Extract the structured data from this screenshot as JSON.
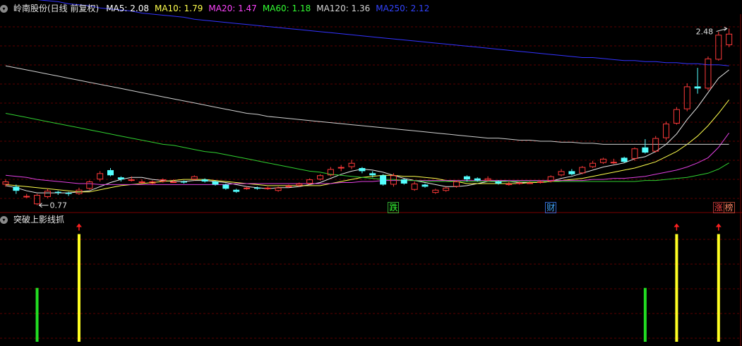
{
  "colors": {
    "background": "#000000",
    "grid": "#5a0000",
    "up_candle": "#ff3a3a",
    "down_candle": "#54ffff",
    "ma5": "#e8e8e8",
    "ma10": "#ffff4d",
    "ma20": "#e040e0",
    "ma60": "#30d030",
    "ma120": "#d0d0d0",
    "ma250": "#3333ff",
    "signal_green": "#22dd22",
    "signal_yellow": "#ffff22",
    "arrow_red": "#ff2020"
  },
  "header": {
    "collapse_icon": "chevron-down-icon",
    "stock_title": "岭南股份(日线 前复权)",
    "ma_items": [
      {
        "label": "MA5: 2.08",
        "color": "#ffffff"
      },
      {
        "label": "MA10: 1.79",
        "color": "#ffff4d"
      },
      {
        "label": "MA20: 1.47",
        "color": "#ff44ff"
      },
      {
        "label": "MA60: 1.18",
        "color": "#33ff33"
      },
      {
        "label": "MA120: 1.36",
        "color": "#d8d8d8"
      },
      {
        "label": "MA250: 2.12",
        "color": "#3344ff"
      }
    ]
  },
  "indicator": {
    "collapse_icon": "chevron-down-icon",
    "title": "突破上影线抓"
  },
  "annotations": {
    "high_label": "2.48",
    "low_label": "0.77",
    "tags": [
      {
        "text": "跌",
        "color": "#33ff33",
        "border": "#33aa33",
        "index": 37
      },
      {
        "text": "财",
        "color": "#44aaff",
        "border": "#3366cc",
        "index": 52
      },
      {
        "text": "涨",
        "color": "#ff4444",
        "border": "#aa3333",
        "index": 68
      },
      {
        "text": "榜",
        "color": "#ff8866",
        "border": "#aa4433",
        "index": 69
      }
    ]
  },
  "chart_data": [
    {
      "type": "candlestick",
      "title": "岭南股份(日线 前复权)",
      "ylim": [
        0.72,
        2.62
      ],
      "candles": [
        [
          0.97,
          1.0,
          1.02,
          0.95
        ],
        [
          0.95,
          0.91,
          0.97,
          0.88
        ],
        [
          0.86,
          0.86,
          0.88,
          0.84
        ],
        [
          0.78,
          0.87,
          0.88,
          0.77
        ],
        [
          0.85,
          0.91,
          0.93,
          0.84
        ],
        [
          0.9,
          0.89,
          0.91,
          0.87
        ],
        [
          0.89,
          0.88,
          0.9,
          0.86
        ],
        [
          0.88,
          0.92,
          0.94,
          0.87
        ],
        [
          0.93,
          1.0,
          1.01,
          0.92
        ],
        [
          1.02,
          1.08,
          1.1,
          1.0
        ],
        [
          1.11,
          1.06,
          1.13,
          1.05
        ],
        [
          1.04,
          1.02,
          1.05,
          1.0
        ],
        [
          1.02,
          1.02,
          1.05,
          1.0
        ],
        [
          1.0,
          1.0,
          1.02,
          0.98
        ],
        [
          0.98,
          1.0,
          1.01,
          0.97
        ],
        [
          1.0,
          1.02,
          1.03,
          0.99
        ],
        [
          1.0,
          1.0,
          1.02,
          0.99
        ],
        [
          1.0,
          0.99,
          1.01,
          0.98
        ],
        [
          1.02,
          1.05,
          1.06,
          1.01
        ],
        [
          1.02,
          1.0,
          1.03,
          0.99
        ],
        [
          1.0,
          0.97,
          1.01,
          0.96
        ],
        [
          0.97,
          0.93,
          0.98,
          0.92
        ],
        [
          0.92,
          0.9,
          0.93,
          0.89
        ],
        [
          0.93,
          0.94,
          0.95,
          0.92
        ],
        [
          0.94,
          0.93,
          0.95,
          0.92
        ],
        [
          0.93,
          0.94,
          0.95,
          0.92
        ],
        [
          0.91,
          0.94,
          0.95,
          0.9
        ],
        [
          0.95,
          0.96,
          0.97,
          0.94
        ],
        [
          0.96,
          0.98,
          0.99,
          0.95
        ],
        [
          0.98,
          1.02,
          1.03,
          0.97
        ],
        [
          1.02,
          1.06,
          1.07,
          1.01
        ],
        [
          1.06,
          1.12,
          1.14,
          1.05
        ],
        [
          1.13,
          1.14,
          1.16,
          1.1
        ],
        [
          1.14,
          1.18,
          1.21,
          1.12
        ],
        [
          1.13,
          1.1,
          1.14,
          1.08
        ],
        [
          1.08,
          1.06,
          1.1,
          1.04
        ],
        [
          1.06,
          0.97,
          1.07,
          0.96
        ],
        [
          0.97,
          1.06,
          1.08,
          0.95
        ],
        [
          1.02,
          0.98,
          1.03,
          0.97
        ],
        [
          0.92,
          0.98,
          1.0,
          0.91
        ],
        [
          0.97,
          0.95,
          0.98,
          0.94
        ],
        [
          0.89,
          0.92,
          0.93,
          0.88
        ],
        [
          0.91,
          0.94,
          0.95,
          0.9
        ],
        [
          0.95,
          1.0,
          1.01,
          0.94
        ],
        [
          1.05,
          1.02,
          1.06,
          1.0
        ],
        [
          1.03,
          1.01,
          1.04,
          1.0
        ],
        [
          1.01,
          1.03,
          1.05,
          1.0
        ],
        [
          1.0,
          0.98,
          1.01,
          0.97
        ],
        [
          0.98,
          0.98,
          1.0,
          0.96
        ],
        [
          0.98,
          0.99,
          1.0,
          0.97
        ],
        [
          0.99,
          0.99,
          1.0,
          0.98
        ],
        [
          0.99,
          1.0,
          1.01,
          0.98
        ],
        [
          1.0,
          1.05,
          1.06,
          0.99
        ],
        [
          1.06,
          1.1,
          1.12,
          1.05
        ],
        [
          1.1,
          1.07,
          1.12,
          1.06
        ],
        [
          1.08,
          1.14,
          1.15,
          1.07
        ],
        [
          1.14,
          1.18,
          1.2,
          1.13
        ],
        [
          1.18,
          1.22,
          1.23,
          1.17
        ],
        [
          1.19,
          1.19,
          1.22,
          1.17
        ],
        [
          1.23,
          1.19,
          1.24,
          1.18
        ],
        [
          1.22,
          1.32,
          1.33,
          1.2
        ],
        [
          1.33,
          1.28,
          1.41,
          1.27
        ],
        [
          1.29,
          1.42,
          1.44,
          1.28
        ],
        [
          1.42,
          1.56,
          1.58,
          1.4
        ],
        [
          1.56,
          1.7,
          1.72,
          1.55
        ],
        [
          1.7,
          1.92,
          1.95,
          1.68
        ],
        [
          1.92,
          1.9,
          2.1,
          1.85
        ],
        [
          1.9,
          2.19,
          2.21,
          1.88
        ],
        [
          2.18,
          2.42,
          2.45,
          2.17
        ],
        [
          2.32,
          2.43,
          2.48,
          2.3
        ]
      ],
      "series": [
        {
          "name": "MA5",
          "values": [
            0.96,
            0.94,
            0.91,
            0.89,
            0.89,
            0.89,
            0.89,
            0.9,
            0.91,
            0.95,
            0.99,
            1.02,
            1.04,
            1.04,
            1.02,
            1.01,
            1.0,
            1.0,
            1.01,
            1.01,
            1.0,
            0.99,
            0.97,
            0.95,
            0.94,
            0.93,
            0.94,
            0.94,
            0.95,
            0.97,
            0.99,
            1.03,
            1.07,
            1.1,
            1.12,
            1.11,
            1.09,
            1.06,
            1.03,
            1.01,
            0.99,
            0.97,
            0.95,
            0.95,
            0.96,
            0.98,
            1.0,
            1.01,
            1.0,
            0.99,
            0.99,
            0.99,
            1.0,
            1.03,
            1.05,
            1.08,
            1.11,
            1.14,
            1.16,
            1.18,
            1.22,
            1.24,
            1.29,
            1.36,
            1.46,
            1.6,
            1.72,
            1.86,
            2.0,
            2.08
          ]
        },
        {
          "name": "MA10",
          "values": [
            0.97,
            0.96,
            0.95,
            0.94,
            0.93,
            0.92,
            0.91,
            0.9,
            0.9,
            0.92,
            0.94,
            0.96,
            0.97,
            0.98,
            0.99,
            1.0,
            1.01,
            1.02,
            1.02,
            1.02,
            1.01,
            1.0,
            0.99,
            0.98,
            0.97,
            0.96,
            0.96,
            0.96,
            0.96,
            0.96,
            0.96,
            0.98,
            1.0,
            1.02,
            1.04,
            1.05,
            1.06,
            1.06,
            1.05,
            1.05,
            1.04,
            1.03,
            1.01,
            1.0,
            0.98,
            0.98,
            0.98,
            0.98,
            0.98,
            0.98,
            0.99,
            0.99,
            1.0,
            1.01,
            1.02,
            1.03,
            1.05,
            1.07,
            1.09,
            1.11,
            1.13,
            1.16,
            1.19,
            1.24,
            1.29,
            1.36,
            1.44,
            1.54,
            1.66,
            1.79
          ]
        },
        {
          "name": "MA20",
          "values": [
            1.06,
            1.05,
            1.04,
            1.02,
            1.01,
            1.0,
            0.99,
            0.98,
            0.98,
            0.97,
            0.97,
            0.97,
            0.97,
            0.97,
            0.97,
            0.97,
            0.97,
            0.97,
            0.97,
            0.97,
            0.97,
            0.97,
            0.98,
            0.98,
            0.98,
            0.98,
            0.98,
            0.98,
            0.98,
            0.98,
            0.98,
            0.98,
            0.99,
            0.99,
            1.0,
            1.0,
            1.01,
            1.01,
            1.01,
            1.01,
            1.01,
            1.01,
            1.01,
            1.01,
            1.01,
            1.01,
            1.01,
            1.01,
            1.01,
            1.01,
            1.01,
            1.01,
            1.01,
            1.01,
            1.01,
            1.01,
            1.02,
            1.02,
            1.03,
            1.03,
            1.04,
            1.05,
            1.07,
            1.09,
            1.11,
            1.14,
            1.18,
            1.23,
            1.33,
            1.47
          ]
        },
        {
          "name": "MA60",
          "values": [
            1.66,
            1.64,
            1.62,
            1.6,
            1.58,
            1.56,
            1.54,
            1.52,
            1.5,
            1.48,
            1.46,
            1.44,
            1.42,
            1.4,
            1.38,
            1.36,
            1.35,
            1.33,
            1.31,
            1.29,
            1.28,
            1.26,
            1.24,
            1.22,
            1.2,
            1.18,
            1.16,
            1.14,
            1.12,
            1.1,
            1.09,
            1.07,
            1.06,
            1.05,
            1.04,
            1.03,
            1.02,
            1.02,
            1.01,
            1.01,
            1.0,
            1.0,
            1.0,
            1.0,
            1.0,
            1.0,
            1.0,
            1.0,
            1.0,
            1.0,
            1.0,
            1.0,
            1.0,
            1.0,
            1.0,
            1.0,
            1.0,
            1.0,
            1.0,
            1.0,
            1.0,
            1.01,
            1.01,
            1.02,
            1.03,
            1.04,
            1.06,
            1.08,
            1.12,
            1.18
          ]
        },
        {
          "name": "MA120",
          "values": [
            2.12,
            2.1,
            2.08,
            2.06,
            2.04,
            2.02,
            2.0,
            1.98,
            1.96,
            1.94,
            1.92,
            1.9,
            1.88,
            1.86,
            1.84,
            1.82,
            1.8,
            1.78,
            1.76,
            1.74,
            1.72,
            1.7,
            1.68,
            1.66,
            1.65,
            1.63,
            1.62,
            1.61,
            1.6,
            1.59,
            1.58,
            1.57,
            1.56,
            1.55,
            1.54,
            1.53,
            1.52,
            1.51,
            1.5,
            1.49,
            1.48,
            1.47,
            1.46,
            1.45,
            1.44,
            1.43,
            1.42,
            1.42,
            1.41,
            1.4,
            1.4,
            1.39,
            1.39,
            1.38,
            1.38,
            1.37,
            1.37,
            1.36,
            1.36,
            1.36,
            1.36,
            1.36,
            1.36,
            1.36,
            1.36,
            1.36,
            1.36,
            1.36,
            1.36,
            1.36
          ]
        },
        {
          "name": "MA250",
          "values": [
            2.8,
            2.79,
            2.78,
            2.76,
            2.75,
            2.74,
            2.72,
            2.71,
            2.7,
            2.68,
            2.67,
            2.66,
            2.65,
            2.63,
            2.62,
            2.61,
            2.6,
            2.59,
            2.57,
            2.56,
            2.55,
            2.54,
            2.53,
            2.52,
            2.51,
            2.5,
            2.49,
            2.48,
            2.47,
            2.46,
            2.45,
            2.44,
            2.43,
            2.42,
            2.41,
            2.4,
            2.39,
            2.38,
            2.37,
            2.36,
            2.35,
            2.34,
            2.33,
            2.32,
            2.31,
            2.3,
            2.29,
            2.28,
            2.27,
            2.26,
            2.25,
            2.24,
            2.23,
            2.22,
            2.21,
            2.2,
            2.2,
            2.19,
            2.18,
            2.17,
            2.17,
            2.16,
            2.16,
            2.15,
            2.15,
            2.14,
            2.14,
            2.13,
            2.13,
            2.12
          ]
        }
      ]
    },
    {
      "type": "bar",
      "title": "突破上影线抓",
      "ylim": [
        0,
        1.2
      ],
      "bars": [
        {
          "index": 3,
          "value": 0.5,
          "color": "green"
        },
        {
          "index": 7,
          "value": 1.0,
          "color": "yellow",
          "arrow": true
        },
        {
          "index": 61,
          "value": 0.5,
          "color": "green"
        },
        {
          "index": 64,
          "value": 1.0,
          "color": "yellow",
          "arrow": true
        },
        {
          "index": 68,
          "value": 1.0,
          "color": "yellow",
          "arrow": true
        }
      ]
    }
  ]
}
